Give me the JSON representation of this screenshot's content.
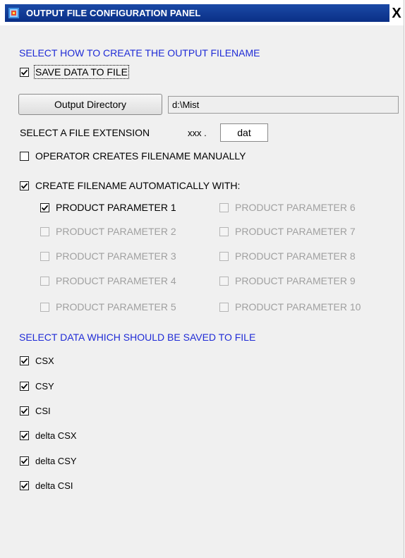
{
  "window": {
    "title": "OUTPUT FILE CONFIGURATION PANEL",
    "close_label": "X",
    "title_bar_color": "#0a2f86"
  },
  "section1": {
    "title": "SELECT HOW TO CREATE THE OUTPUT FILENAME"
  },
  "save_data": {
    "label": "SAVE DATA TO FILE",
    "checked": true
  },
  "output_directory": {
    "button_label": "Output Directory",
    "value": "d:\\Mist"
  },
  "file_extension": {
    "label": "SELECT A FILE EXTENSION",
    "prefix": "xxx .",
    "value": "dat"
  },
  "manual_filename": {
    "label": "OPERATOR CREATES FILENAME MANUALLY",
    "checked": false
  },
  "auto_filename": {
    "label": "CREATE FILENAME AUTOMATICALLY WITH:",
    "checked": true
  },
  "params": [
    {
      "label": "PRODUCT PARAMETER 1",
      "checked": true,
      "enabled": true
    },
    {
      "label": "PRODUCT PARAMETER 2",
      "checked": false,
      "enabled": false
    },
    {
      "label": "PRODUCT PARAMETER 3",
      "checked": false,
      "enabled": false
    },
    {
      "label": "PRODUCT PARAMETER 4",
      "checked": false,
      "enabled": false
    },
    {
      "label": "PRODUCT PARAMETER 5",
      "checked": false,
      "enabled": false
    },
    {
      "label": "PRODUCT PARAMETER 6",
      "checked": false,
      "enabled": false
    },
    {
      "label": "PRODUCT PARAMETER 7",
      "checked": false,
      "enabled": false
    },
    {
      "label": "PRODUCT PARAMETER 8",
      "checked": false,
      "enabled": false
    },
    {
      "label": "PRODUCT PARAMETER 9",
      "checked": false,
      "enabled": false
    },
    {
      "label": "PRODUCT PARAMETER 10",
      "checked": false,
      "enabled": false
    }
  ],
  "section2": {
    "title": "SELECT DATA WHICH SHOULD BE SAVED TO FILE"
  },
  "data_items": [
    {
      "label": "CSX",
      "checked": true
    },
    {
      "label": "CSY",
      "checked": true
    },
    {
      "label": "CSI",
      "checked": true
    },
    {
      "label": "delta CSX",
      "checked": true
    },
    {
      "label": "delta CSY",
      "checked": true
    },
    {
      "label": "delta CSI",
      "checked": true
    }
  ],
  "colors": {
    "section_title": "#1f2bd6",
    "disabled_text": "#a0a0a0",
    "panel_background": "#f0f0f0"
  }
}
